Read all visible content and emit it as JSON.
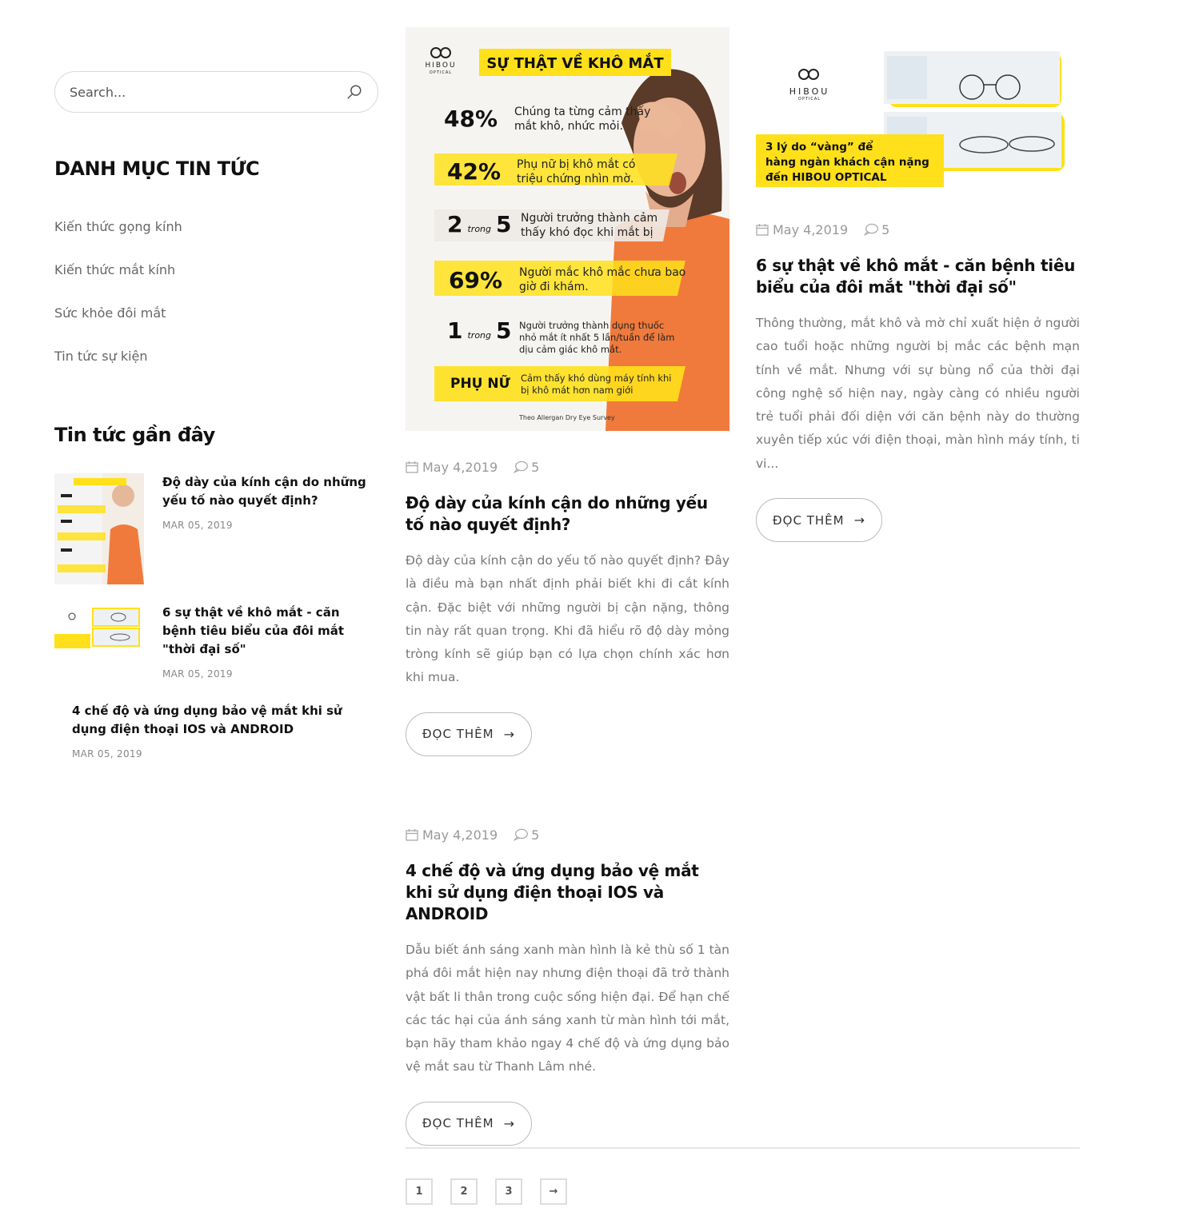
{
  "search": {
    "placeholder": "Search..."
  },
  "categories": {
    "title": "DANH MỤC TIN TỨC",
    "items": [
      "Kiến thức gọng kính",
      "Kiến thức mắt kính",
      "Sức khỏe đôi mắt",
      "Tin tức sự kiện"
    ]
  },
  "recent": {
    "title": "Tin tức gần đây",
    "items": [
      {
        "title": "Độ dày của kính cận do những yếu tố nào quyết định?",
        "date": "MAR 05, 2019"
      },
      {
        "title": "6 sự thật về khô mắt - căn bệnh tiêu biểu của đôi mắt \"thời đại số\"",
        "date": "MAR 05, 2019"
      },
      {
        "title": "4 chế độ và ứng dụng bảo vệ mắt khi sử dụng điện thoại IOS và ANDROID",
        "date": "MAR 05, 2019"
      }
    ]
  },
  "infographic": {
    "brand": "HIBOU",
    "brand_sub": "OPTICAL",
    "heading": "SỰ THẬT VỀ KHÔ MẮT",
    "rows": [
      {
        "stat": "48%",
        "text": "Chúng ta từng cảm thấy mắt khô, nhức mỏi."
      },
      {
        "stat": "42%",
        "text": "Phụ nữ bị khô mắt có triệu chứng nhìn mờ."
      },
      {
        "stat_a": "2",
        "stat_mid": "trong",
        "stat_b": "5",
        "text": "Người trưởng thành cảm thấy khó đọc khi mắt bị"
      },
      {
        "stat": "69%",
        "text": "Người mắc khô mắc chưa bao giờ đi khám."
      },
      {
        "stat_a": "1",
        "stat_mid": "trong",
        "stat_b": "5",
        "text": "Người trưởng thành dụng thuốc nhỏ mắt ít nhất 5 lần/tuần để làm dịu cảm giác khô mắt."
      },
      {
        "stat": "PHỤ NỮ",
        "text": "Cảm thấy khó dùng máy tính khi bị khô mát hơn nam giới"
      }
    ],
    "source": "Theo Allergan Dry Eye Survey"
  },
  "promo": {
    "brand": "HIBOU",
    "brand_sub": "OPTICAL",
    "caption_1": "3 lý do “vàng” để",
    "caption_2": "hàng ngàn khách cận nặng",
    "caption_3": "đến HIBOU OPTICAL"
  },
  "posts": [
    {
      "date": "May 4,2019",
      "comments": "5",
      "title": "Độ dày của kính cận do những yếu tố nào quyết định?",
      "excerpt": "Độ dày của kính cận do yếu tố nào quyết định? Đây là điều mà bạn nhất định phải biết khi đi cắt kính cận. Đặc biệt với những người bị cận nặng, thông tin này rất quan trọng. Khi đã hiểu rõ độ dày mỏng tròng kính sẽ giúp bạn có lựa chọn chính xác hơn khi mua.",
      "read_more": "ĐỌC THÊM"
    },
    {
      "date": "May 4,2019",
      "comments": "5",
      "title": "6 sự thật về khô mắt - căn bệnh tiêu biểu của đôi mắt \"thời đại số\"",
      "excerpt": "Thông thường, mắt khô và mờ chỉ xuất hiện ở người cao tuổi hoặc những người bị mắc các bệnh mạn tính về mắt. Nhưng với sự bùng nổ của thời đại công nghệ số hiện nay, ngày càng có nhiều người trẻ tuổi phải đối diện với căn bệnh này do thường xuyên tiếp xúc với điện thoại, màn hình máy tính, ti vi...",
      "read_more": "ĐỌC THÊM"
    },
    {
      "date": "May 4,2019",
      "comments": "5",
      "title": "4 chế độ và ứng dụng bảo vệ mắt khi sử dụng điện thoại IOS và ANDROID",
      "excerpt": "Dẫu biết ánh sáng xanh màn hình là kẻ thù số 1 tàn phá đôi mắt hiện nay nhưng điện thoại đã trở thành vật bất li thân trong cuộc sống hiện đại. Để hạn chế các tác hại của ánh sáng xanh từ màn hình tới mắt, bạn hãy tham khảo ngay 4 chế độ và ứng dụng bảo vệ mắt sau từ Thanh Lâm nhé.",
      "read_more": "ĐỌC THÊM"
    }
  ],
  "pagination": {
    "pages": [
      "1",
      "2",
      "3"
    ],
    "next": "→"
  },
  "colors": {
    "accent_yellow": "#ffe01b",
    "orange_shirt": "#f07a3c",
    "text_dark": "#111111",
    "text_muted": "#777777"
  }
}
